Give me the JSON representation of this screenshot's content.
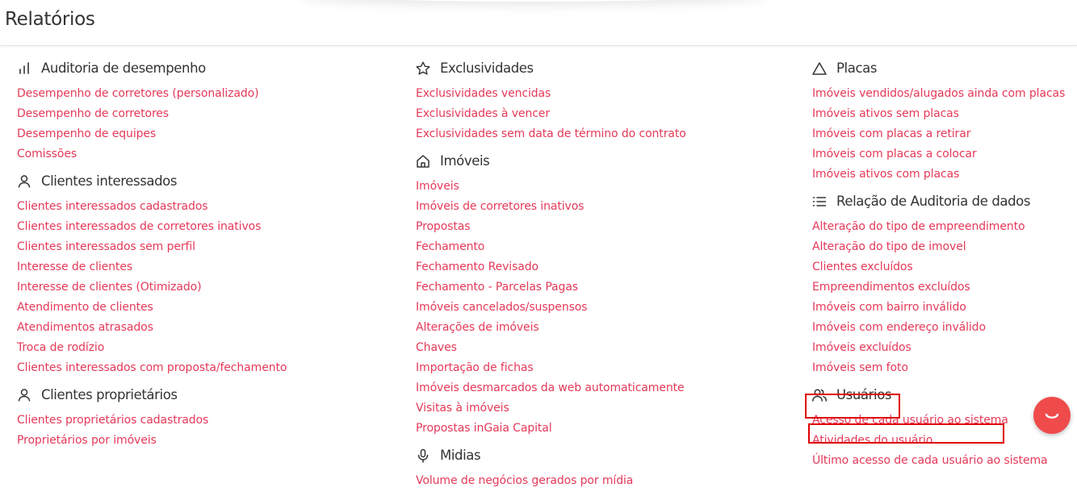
{
  "page_title": "Relatórios",
  "colors": {
    "link": "#e53958",
    "heading": "#333333",
    "highlight_box": "#e00000",
    "chat_button": "#ef4b4b"
  },
  "columns": [
    {
      "sections": [
        {
          "title": "Auditoria de desempenho",
          "icon": "bar-chart-icon",
          "links": [
            "Desempenho de corretores (personalizado)",
            "Desempenho de corretores",
            "Desempenho de equipes",
            "Comissões"
          ]
        },
        {
          "title": "Clientes interessados",
          "icon": "person-icon",
          "links": [
            "Clientes interessados cadastrados",
            "Clientes interessados de corretores inativos",
            "Clientes interessados sem perfil",
            "Interesse de clientes",
            "Interesse de clientes (Otimizado)",
            "Atendimento de clientes",
            "Atendimentos atrasados",
            "Troca de rodízio",
            "Clientes interessados com proposta/fechamento"
          ]
        },
        {
          "title": "Clientes proprietários",
          "icon": "person-icon",
          "links": [
            "Clientes proprietários cadastrados",
            "Proprietários por imóveis"
          ]
        }
      ]
    },
    {
      "sections": [
        {
          "title": "Exclusividades",
          "icon": "star-icon",
          "links": [
            "Exclusividades vencidas",
            "Exclusividades à vencer",
            "Exclusividades sem data de término do contrato"
          ]
        },
        {
          "title": "Imóveis",
          "icon": "home-icon",
          "links": [
            "Imóveis",
            "Imóveis de corretores inativos",
            "Propostas",
            "Fechamento",
            "Fechamento Revisado",
            "Fechamento - Parcelas Pagas",
            "Imóveis cancelados/suspensos",
            "Alterações de imóveis",
            "Chaves",
            "Importação de fichas",
            "Imóveis desmarcados da web automaticamente",
            "Visitas à imóveis",
            "Propostas inGaia Capital"
          ]
        },
        {
          "title": "Midias",
          "icon": "microphone-icon",
          "links": [
            "Volume de negócios gerados por mídia"
          ]
        }
      ]
    },
    {
      "sections": [
        {
          "title": "Placas",
          "icon": "triangle-icon",
          "links": [
            "Imóveis vendidos/alugados ainda com placas",
            "Imóveis ativos sem placas",
            "Imóveis com placas a retirar",
            "Imóveis com placas a colocar",
            "Imóveis ativos com placas"
          ]
        },
        {
          "title": "Relação de Auditoria de dados",
          "icon": "list-icon",
          "links": [
            "Alteração do tipo de empreendimento",
            "Alteração do tipo de imovel",
            "Clientes excluídos",
            "Empreendimentos excluídos",
            "Imóveis com bairro inválido",
            "Imóveis com endereço inválido",
            "Imóveis excluídos",
            "Imóveis sem foto"
          ]
        },
        {
          "title": "Usuários",
          "icon": "users-icon",
          "links": [
            "Acesso de cada usuário ao sistema",
            "Atividades do usuário",
            "Último acesso de cada usuário ao sistema"
          ]
        }
      ]
    }
  ],
  "chat_button_icon": "chat-smile-icon"
}
